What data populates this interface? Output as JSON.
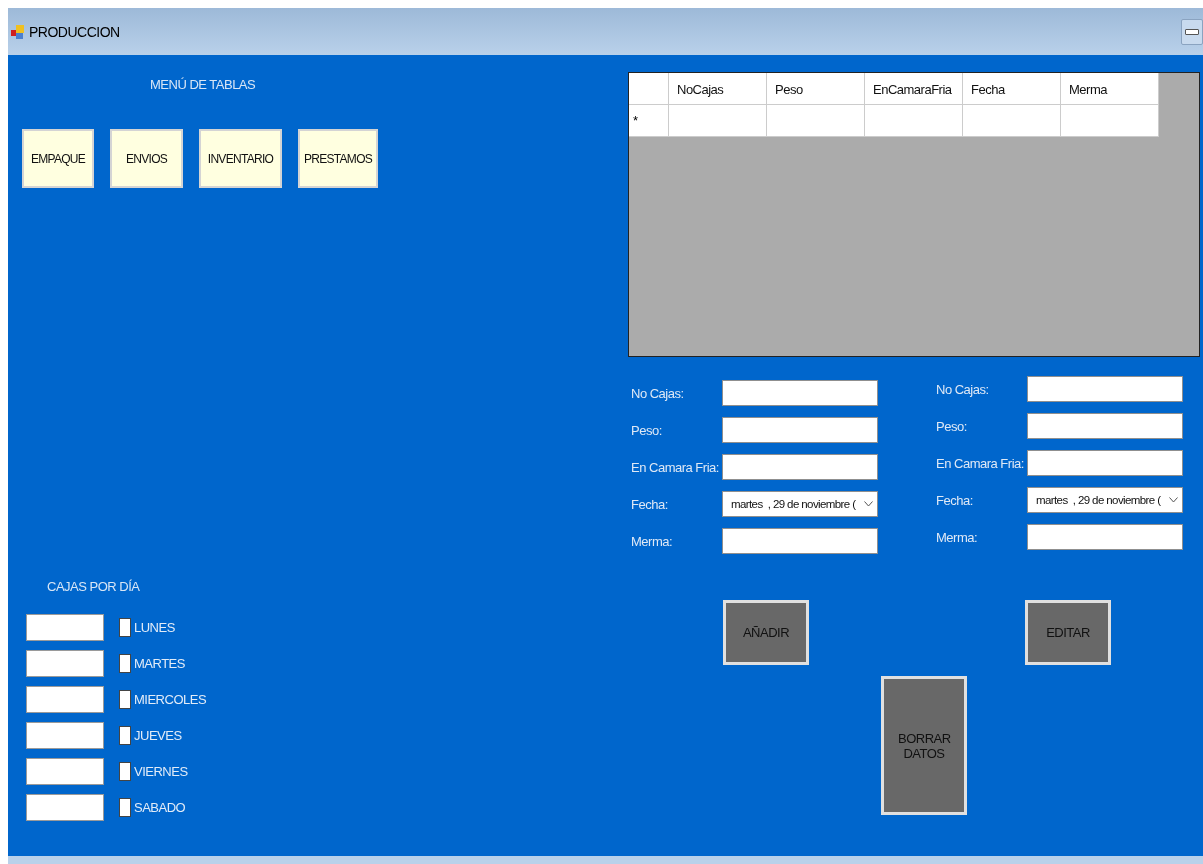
{
  "window": {
    "title": "PRODUCCION"
  },
  "menu": {
    "title": "MENÚ DE TABLAS",
    "buttons": [
      "EMPAQUE",
      "ENVIOS",
      "INVENTARIO",
      "PRESTAMOS"
    ]
  },
  "days": {
    "title": "CAJAS POR DÍA",
    "items": [
      {
        "label": "LUNES",
        "checked": false
      },
      {
        "label": "MARTES",
        "checked": false
      },
      {
        "label": "MIERCOLES",
        "checked": false
      },
      {
        "label": "JUEVES",
        "checked": false
      },
      {
        "label": "VIERNES",
        "checked": false
      },
      {
        "label": "SABADO",
        "checked": false
      }
    ]
  },
  "table": {
    "columns": [
      "NoCajas",
      "Peso",
      "EnCamaraFria",
      "Fecha",
      "Merma"
    ],
    "new_row_marker": "*"
  },
  "forms": [
    {
      "fields": [
        {
          "label": "No Cajas:",
          "kind": "text"
        },
        {
          "label": "Peso:",
          "kind": "text"
        },
        {
          "label": "En Camara Fria:",
          "kind": "text"
        },
        {
          "label": "Fecha:",
          "kind": "date",
          "value": "martes  , 29 de noviembre ("
        },
        {
          "label": "Merma:",
          "kind": "text"
        }
      ]
    },
    {
      "fields": [
        {
          "label": "No Cajas:",
          "kind": "text"
        },
        {
          "label": "Peso:",
          "kind": "text"
        },
        {
          "label": "En Camara Fria:",
          "kind": "text"
        },
        {
          "label": "Fecha:",
          "kind": "date",
          "value": "martes  , 29 de noviembre ("
        },
        {
          "label": "Merma:",
          "kind": "text"
        }
      ]
    }
  ],
  "actions": {
    "add": "AÑADIR",
    "edit": "EDITAR",
    "delete": "BORRAR DATOS"
  }
}
